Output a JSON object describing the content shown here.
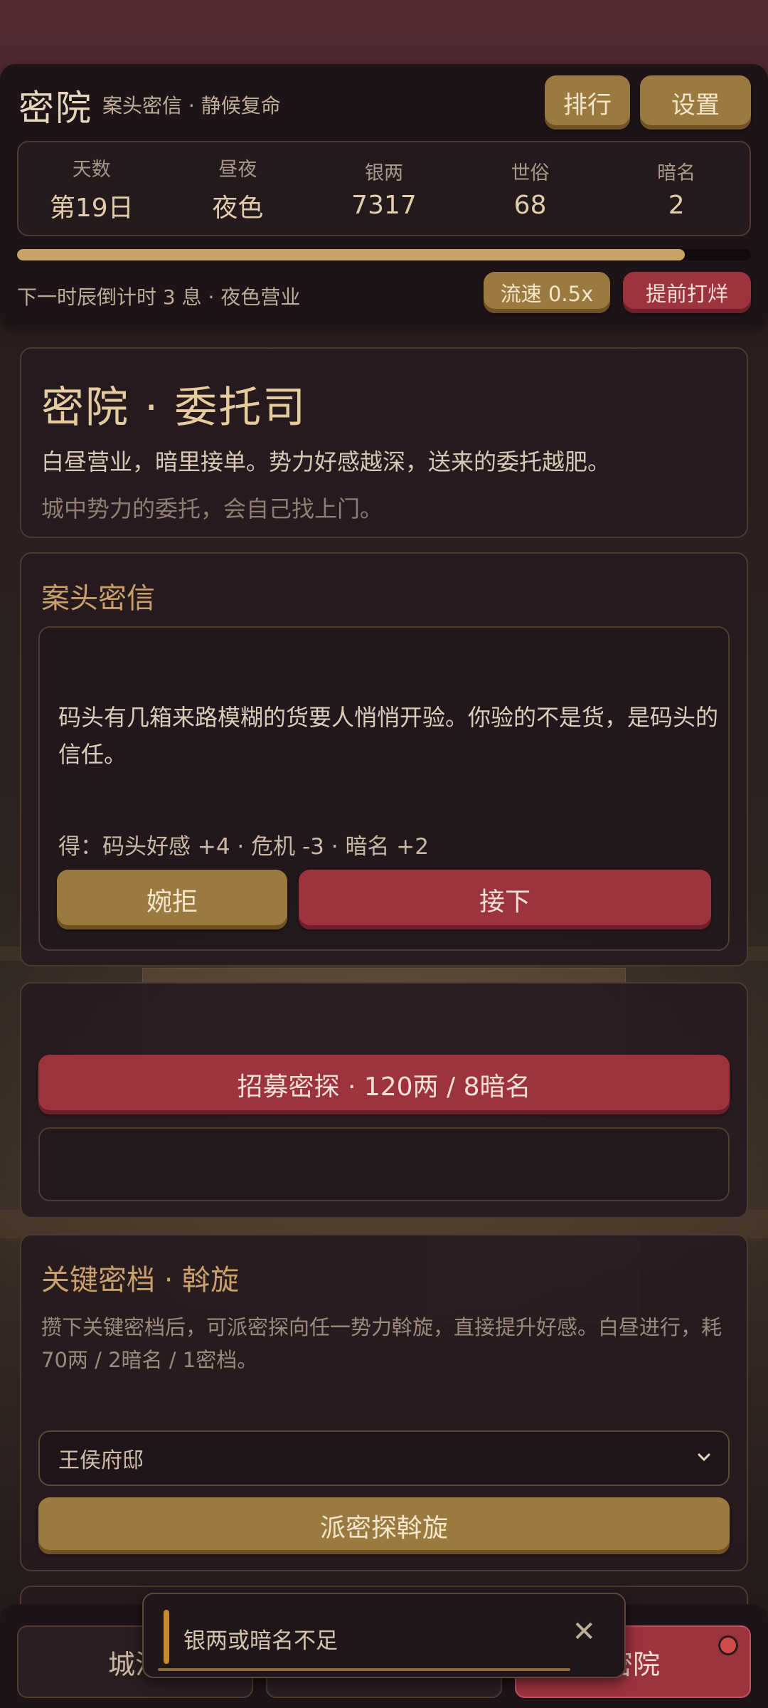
{
  "header": {
    "title": "密院",
    "subtitle": "案头密信 · 静候复命",
    "rank_button": "排行",
    "settings_button": "设置"
  },
  "stats": [
    {
      "label": "天数",
      "value": "第19日"
    },
    {
      "label": "昼夜",
      "value": "夜色"
    },
    {
      "label": "银两",
      "value": "7317"
    },
    {
      "label": "世俗",
      "value": "68"
    },
    {
      "label": "暗名",
      "value": "2"
    }
  ],
  "progress": {
    "fraction": 0.91
  },
  "timer_text": "下一时辰倒计时 3 息 · 夜色营业",
  "speed_button": "流速 0.5x",
  "close_early_button": "提前打烊",
  "intro": {
    "title": "密院 · 委托司",
    "desc": "白昼营业，暗里接单。势力好感越深，送来的委托越肥。",
    "hint": "城中势力的委托，会自己找上门。"
  },
  "letter_panel": {
    "title": "案头密信",
    "body": "码头有几箱来路模糊的货要人悄悄开验。你验的不是货，是码头的信任。",
    "reward": "得：码头好感 +4 · 危机 -3 · 暗名 +2",
    "decline_button": "婉拒",
    "accept_button": "接下"
  },
  "recruit": {
    "button": "招募密探 · 120两 / 8暗名"
  },
  "archive": {
    "title": "关键密档 · 斡旋",
    "desc": "攒下关键密档后，可派密探向任一势力斡旋，直接提升好感。白昼进行，耗 70两 / 2暗名 / 1密档。",
    "selected_faction": "王侯府邸",
    "mediate_button": "派密探斡旋"
  },
  "nav": {
    "tab1": "城池",
    "tab3": "密院"
  },
  "toast": {
    "message": "银两或暗名不足",
    "close": "✕"
  },
  "colors": {
    "gold": "#9a7a3e",
    "red": "#9e3340",
    "progress": "#c9a364"
  }
}
